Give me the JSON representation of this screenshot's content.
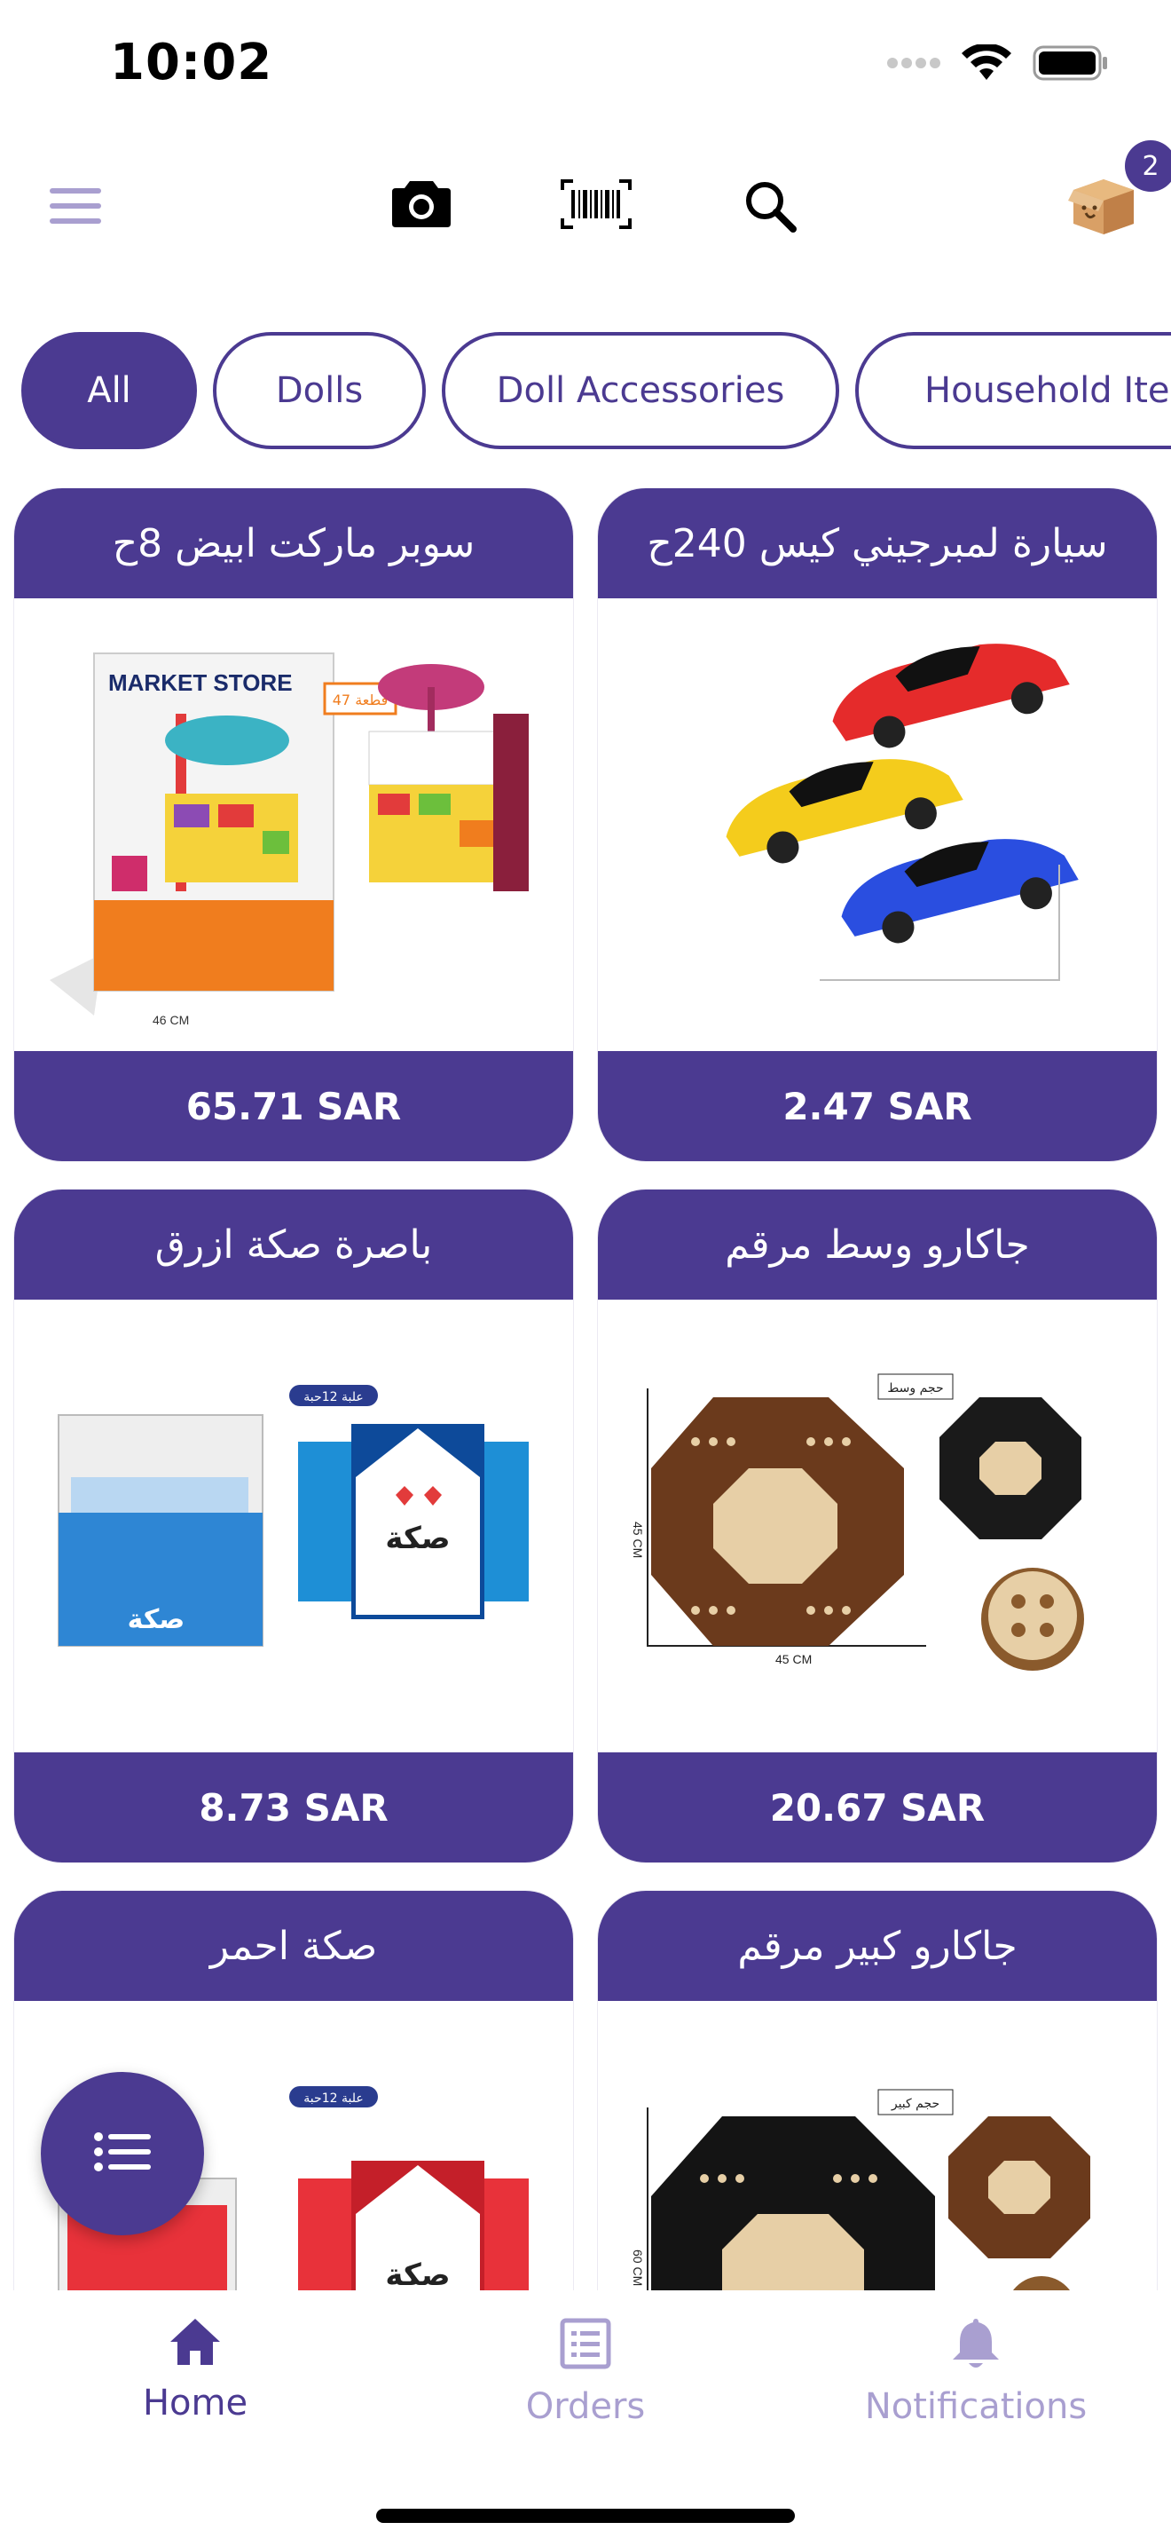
{
  "status": {
    "time": "10:02"
  },
  "toolbar": {
    "cart_badge": "2",
    "icons": [
      "menu-icon",
      "camera-icon",
      "barcode-icon",
      "search-icon",
      "cart-box-icon"
    ]
  },
  "categories": [
    {
      "label": "All",
      "active": true
    },
    {
      "label": "Dolls",
      "active": false
    },
    {
      "label": "Doll Accessories",
      "active": false
    },
    {
      "label": "Household Iter",
      "active": false
    }
  ],
  "products": [
    {
      "title": "سوبر ماركت ابيض 8ح",
      "price": "65.71 SAR"
    },
    {
      "title": "سيارة لمبرجيني كيس 240ح",
      "price": "2.47 SAR"
    },
    {
      "title": "باصرة صكة ازرق",
      "price": "8.73 SAR"
    },
    {
      "title": "جاكارو وسط مرقم",
      "price": "20.67 SAR"
    },
    {
      "title": "صكة احمر",
      "price": ""
    },
    {
      "title": "جاكارو كبير مرقم",
      "price": ""
    }
  ],
  "image_labels": {
    "market_store": "MARKET STORE",
    "pieces_47": "47 قطعة",
    "dim_46cm": "46 CM",
    "box_12": "علبة 12حبة",
    "medium": "حجم وسط",
    "large": "حجم كبير",
    "dim_45cm": "45 CM",
    "dim_60cm": "60 CM",
    "sakka": "صكة"
  },
  "nav": {
    "home": "Home",
    "orders": "Orders",
    "notifications": "Notifications"
  },
  "colors": {
    "brand": "#4b3a91",
    "inactive_nav": "#a99fd0"
  }
}
